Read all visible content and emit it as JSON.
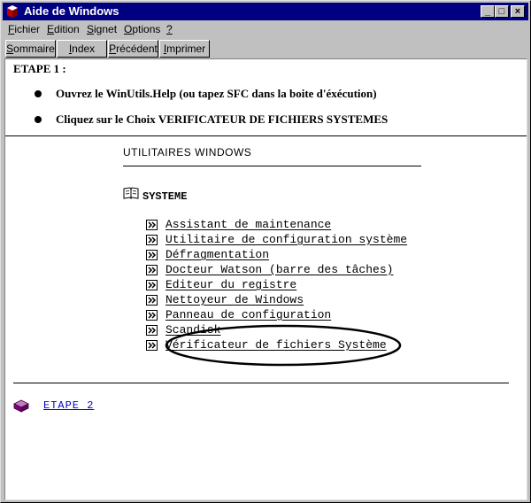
{
  "window": {
    "title": "Aide de Windows",
    "controls": {
      "minimize": "_",
      "maximize": "□",
      "close": "×"
    }
  },
  "menu": [
    {
      "underline": "F",
      "rest": "ichier"
    },
    {
      "underline": "E",
      "rest": "dition"
    },
    {
      "underline": "S",
      "rest": "ignet"
    },
    {
      "underline": "O",
      "rest": "ptions"
    },
    {
      "underline": "?",
      "rest": ""
    }
  ],
  "toolbar": [
    {
      "underline": "S",
      "rest": "ommaire"
    },
    {
      "underline": "I",
      "rest": "ndex"
    },
    {
      "underline": "P",
      "rest": "récédent"
    },
    {
      "underline": "I",
      "rest": "mprimer"
    }
  ],
  "step1": {
    "title": "ETAPE 1 :",
    "bullets": [
      "Ouvrez le WinUtils.Help (ou tapez SFC dans la boite d'éxécution)",
      "Cliquez sur le Choix VERIFICATEUR DE FICHIERS SYSTEMES"
    ]
  },
  "utilities": {
    "title": "UTILITAIRES WINDOWS",
    "section": "SYSTEME",
    "links": [
      "Assistant de maintenance",
      "Utilitaire de configuration système",
      "Défragmentation",
      "Docteur Watson (barre des tâches)",
      "Editeur du registre",
      "Nettoyeur de Windows",
      "Panneau de configuration",
      "Scandisk",
      "Vérificateur de fichiers Système"
    ]
  },
  "step2": {
    "label": "ETAPE 2"
  },
  "colors": {
    "titlebar": "#000080",
    "link": "#0000cc",
    "face": "#c0c0c0"
  }
}
